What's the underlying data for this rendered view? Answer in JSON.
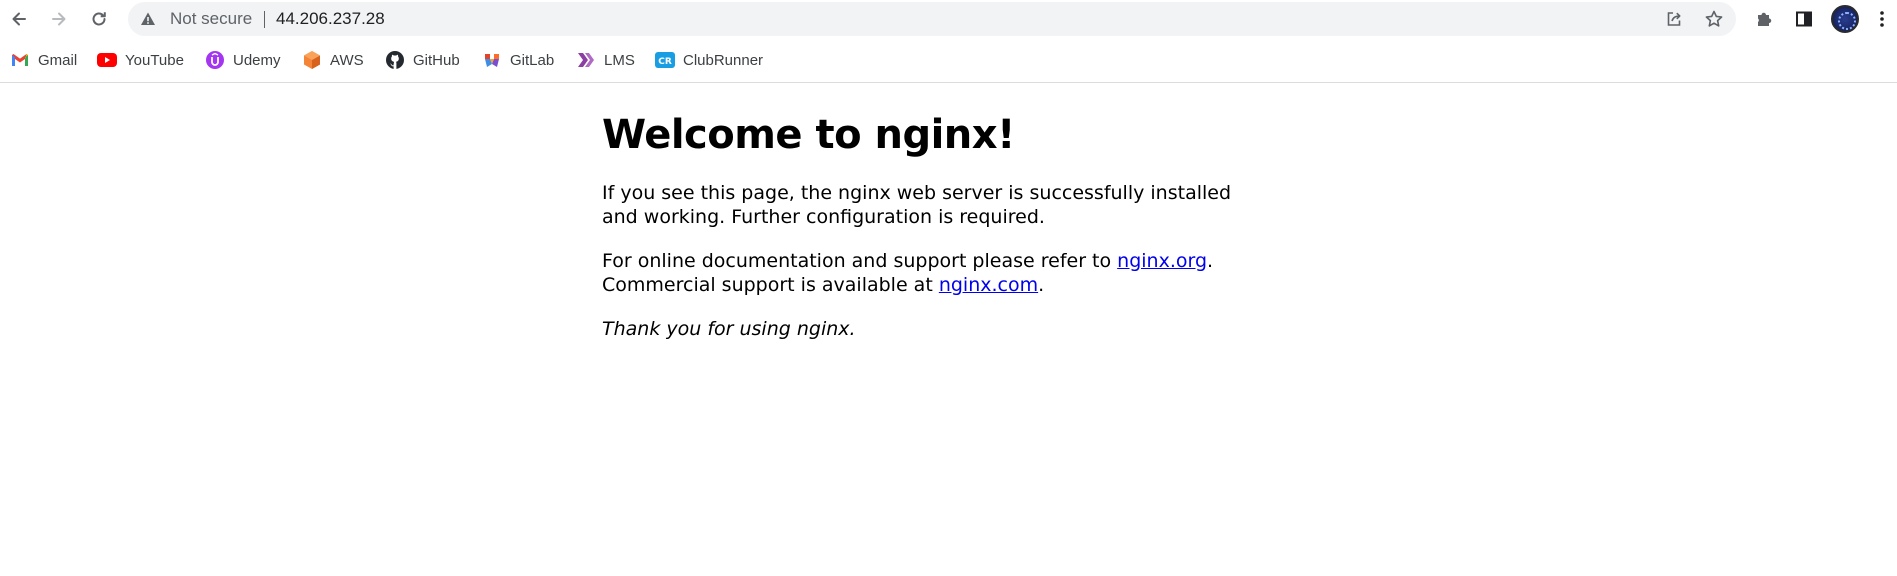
{
  "browser": {
    "security_label": "Not secure",
    "url": "44.206.237.28",
    "bookmarks": [
      {
        "label": "Gmail",
        "icon": "gmail-icon"
      },
      {
        "label": "YouTube",
        "icon": "youtube-icon"
      },
      {
        "label": "Udemy",
        "icon": "udemy-icon"
      },
      {
        "label": "AWS",
        "icon": "aws-icon"
      },
      {
        "label": "GitHub",
        "icon": "github-icon"
      },
      {
        "label": "GitLab",
        "icon": "gitlab-icon"
      },
      {
        "label": "LMS",
        "icon": "lms-icon"
      },
      {
        "label": "ClubRunner",
        "icon": "clubrunner-icon"
      }
    ]
  },
  "page": {
    "title": "Welcome to nginx!",
    "para1": "If you see this page, the nginx web server is successfully installed and working. Further configuration is required.",
    "para2_prefix": "For online documentation and support please refer to ",
    "link_org": "nginx.org",
    "para2_mid": ".",
    "para2_line2_prefix": "Commercial support is available at ",
    "link_com": "nginx.com",
    "para2_suffix": ".",
    "thanks": "Thank you for using nginx."
  }
}
